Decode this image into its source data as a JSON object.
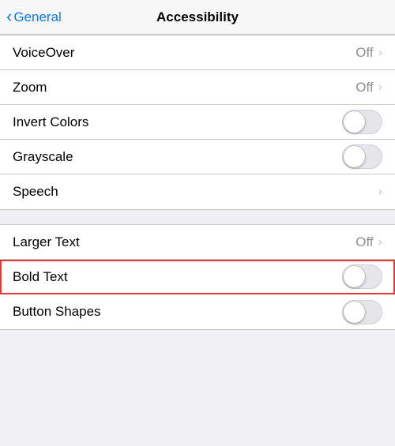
{
  "header": {
    "back_label": "General",
    "title": "Accessibility"
  },
  "sections": [
    {
      "id": "section1",
      "rows": [
        {
          "id": "voiceover",
          "label": "VoiceOver",
          "type": "disclosure",
          "value": "Off"
        },
        {
          "id": "zoom",
          "label": "Zoom",
          "type": "disclosure",
          "value": "Off"
        },
        {
          "id": "invert-colors",
          "label": "Invert Colors",
          "type": "toggle",
          "enabled": false
        },
        {
          "id": "grayscale",
          "label": "Grayscale",
          "type": "toggle",
          "enabled": false
        },
        {
          "id": "speech",
          "label": "Speech",
          "type": "disclosure",
          "value": ""
        }
      ]
    },
    {
      "id": "section2",
      "rows": [
        {
          "id": "larger-text",
          "label": "Larger Text",
          "type": "disclosure",
          "value": "Off"
        },
        {
          "id": "bold-text",
          "label": "Bold Text",
          "type": "toggle",
          "enabled": false,
          "highlighted": true
        },
        {
          "id": "button-shapes",
          "label": "Button Shapes",
          "type": "toggle",
          "enabled": false
        }
      ]
    }
  ],
  "icons": {
    "chevron": "›",
    "back_chevron": "‹"
  }
}
